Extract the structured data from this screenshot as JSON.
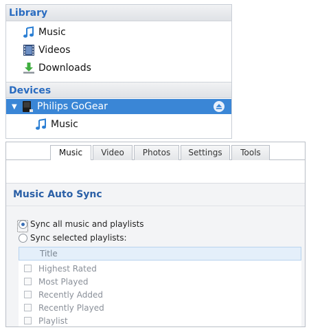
{
  "library": {
    "header": "Library",
    "items": [
      {
        "label": "Music",
        "icon": "music-note-icon"
      },
      {
        "label": "Videos",
        "icon": "film-strip-icon"
      },
      {
        "label": "Downloads",
        "icon": "download-arrow-icon"
      }
    ]
  },
  "devices": {
    "header": "Devices",
    "device": {
      "label": "Philips GoGear",
      "icon": "media-player-device-icon",
      "expanded": true
    },
    "children": [
      {
        "label": "Music",
        "icon": "music-note-icon"
      }
    ]
  },
  "tabs": [
    {
      "label": "Music",
      "active": true
    },
    {
      "label": "Video",
      "active": false
    },
    {
      "label": "Photos",
      "active": false
    },
    {
      "label": "Settings",
      "active": false
    },
    {
      "label": "Tools",
      "active": false
    }
  ],
  "auto_sync": {
    "title": "Music Auto Sync",
    "options": [
      {
        "label": "Sync all music and playlists",
        "selected": true
      },
      {
        "label": "Sync selected playlists:",
        "selected": false
      }
    ],
    "playlist_table": {
      "column": "Title",
      "rows": [
        {
          "label": "Highest Rated",
          "checked": false
        },
        {
          "label": "Most Played",
          "checked": false
        },
        {
          "label": "Recently Added",
          "checked": false
        },
        {
          "label": "Recently Played",
          "checked": false
        },
        {
          "label": "Playlist",
          "checked": false
        }
      ]
    }
  },
  "colors": {
    "section_header_text": "#2a6cc0",
    "selection_bg": "#3a86d6",
    "title_text": "#2a5fa6"
  }
}
